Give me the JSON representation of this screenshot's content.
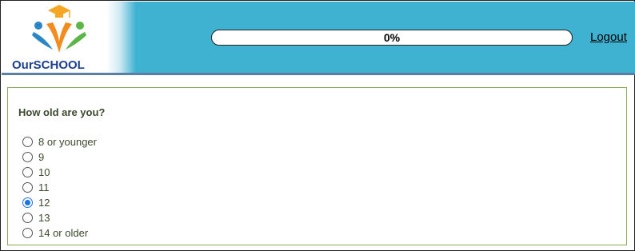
{
  "header": {
    "logo_text": "OurSCHOOL",
    "progress_percent": 0,
    "progress_label": "0%",
    "logout_label": "Logout",
    "colors": {
      "header_bg": "#3fb1d1",
      "logo_text": "#1b3f8f"
    }
  },
  "survey": {
    "question": "How old are you?",
    "options": [
      {
        "label": "8 or younger",
        "selected": false
      },
      {
        "label": "9",
        "selected": false
      },
      {
        "label": "10",
        "selected": false
      },
      {
        "label": "11",
        "selected": false
      },
      {
        "label": "12",
        "selected": true
      },
      {
        "label": "13",
        "selected": false
      },
      {
        "label": "14 or older",
        "selected": false
      }
    ]
  }
}
